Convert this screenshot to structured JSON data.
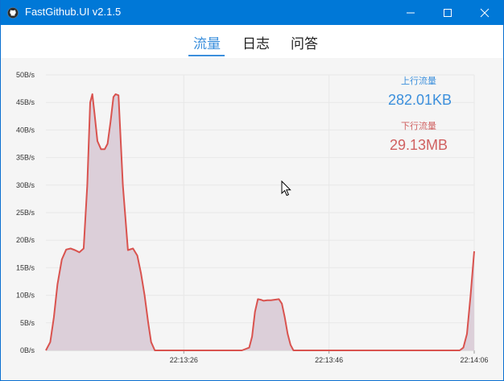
{
  "window": {
    "title": "FastGithub.UI v2.1.5",
    "accent": "#0078d7"
  },
  "tabs": [
    {
      "label": "流量",
      "active": true
    },
    {
      "label": "日志",
      "active": false
    },
    {
      "label": "问答",
      "active": false
    }
  ],
  "stats": {
    "upload_label": "上行流量",
    "upload_value": "282.01KB",
    "upload_color": "#3b8fdc",
    "download_label": "下行流量",
    "download_value": "29.13MB",
    "download_color": "#d06060"
  },
  "chart_data": {
    "type": "area",
    "title": "",
    "xlabel": "",
    "ylabel": "",
    "ylim": [
      0,
      50
    ],
    "yticks": [
      "0B/s",
      "5B/s",
      "10B/s",
      "15B/s",
      "20B/s",
      "25B/s",
      "30B/s",
      "35B/s",
      "40B/s",
      "45B/s",
      "50B/s"
    ],
    "xticks": [
      "22:13:26",
      "22:13:46",
      "22:14:06"
    ],
    "xtick_values": [
      -20,
      0,
      20
    ],
    "xlim": [
      -39,
      20
    ],
    "grid": true,
    "legend": "none",
    "line_color": "#d9534f",
    "fill_color": "#dccfd9",
    "series": [
      {
        "x": [
          -39,
          -38.4,
          -37.9,
          -37.4,
          -36.8,
          -36.2,
          -35.6,
          -35.0,
          -34.4,
          -33.8,
          -33.3,
          -32.9,
          -32.6,
          -32.3,
          -31.9,
          -31.4,
          -30.9,
          -30.5,
          -30.1,
          -29.7,
          -29.4,
          -29.0,
          -28.4,
          -27.7,
          -27.0,
          -26.4,
          -25.9,
          -25.4,
          -24.9,
          -24.5,
          -24.0,
          -23.6,
          -23.1,
          -22.5,
          -21.5,
          -20.0,
          -18.0,
          -16.0,
          -14.0,
          -12.0,
          -11.0,
          -10.6,
          -10.2,
          -9.8,
          -9.4,
          -9.0,
          -8.5,
          -8.0,
          -7.5,
          -6.9,
          -6.5,
          -6.1,
          -5.7,
          -5.3,
          -4.9,
          -4.4,
          -3.0,
          0,
          5,
          10,
          15,
          18.0,
          18.5,
          19.0,
          19.5,
          20.0
        ],
        "y": [
          0,
          1.5,
          6,
          12,
          16.5,
          18.3,
          18.5,
          18.2,
          17.8,
          18.5,
          30,
          45,
          46.5,
          43,
          38,
          36.5,
          36.5,
          37.5,
          41.5,
          46,
          46.5,
          46.3,
          30,
          18.2,
          18.5,
          17.2,
          14,
          10,
          5,
          1.5,
          0,
          0,
          0,
          0,
          0,
          0,
          0,
          0,
          0,
          0,
          0.5,
          2.5,
          7,
          9.3,
          9.2,
          9.0,
          9.1,
          9.1,
          9.2,
          9.3,
          8.5,
          6,
          3,
          1,
          0,
          0,
          0,
          0,
          0,
          0,
          0,
          0,
          0.5,
          3,
          10,
          18
        ]
      }
    ]
  }
}
